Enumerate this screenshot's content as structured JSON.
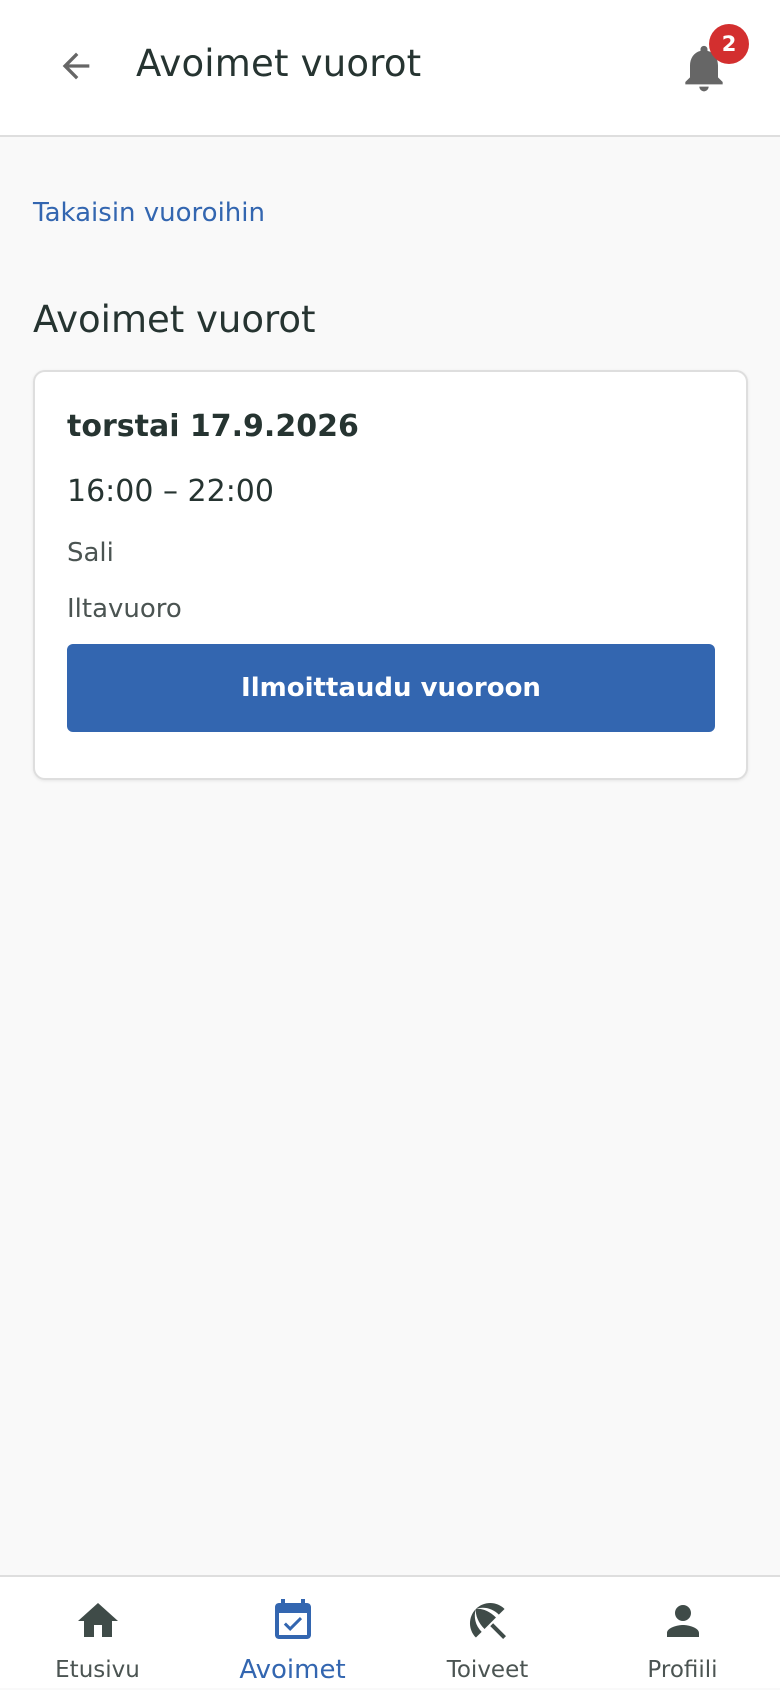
{
  "header": {
    "title": "Avoimet vuorot",
    "notification_count": "2",
    "back_icon": "arrow-left-icon",
    "bell_icon": "bell-icon"
  },
  "back_link": "Takaisin vuoroihin",
  "section_title": "Avoimet vuorot",
  "shift_card": {
    "date": "torstai 17.9.2026",
    "time": "16:00 – 22:00",
    "place": "Sali",
    "type": "Iltavuoro",
    "signup_label": "Ilmoittaudu vuoroon"
  },
  "bottom_nav": {
    "items": [
      {
        "label": "Etusivu",
        "icon": "home-icon",
        "active": false
      },
      {
        "label": "Avoimet",
        "icon": "calendar-check-icon",
        "active": true
      },
      {
        "label": "Toiveet",
        "icon": "beach-umbrella-icon",
        "active": false
      },
      {
        "label": "Profiili",
        "icon": "person-icon",
        "active": false
      }
    ]
  },
  "colors": {
    "accent": "#3366b0",
    "badge": "#d32f2f",
    "text": "#263431",
    "background": "#f9f9f9"
  }
}
